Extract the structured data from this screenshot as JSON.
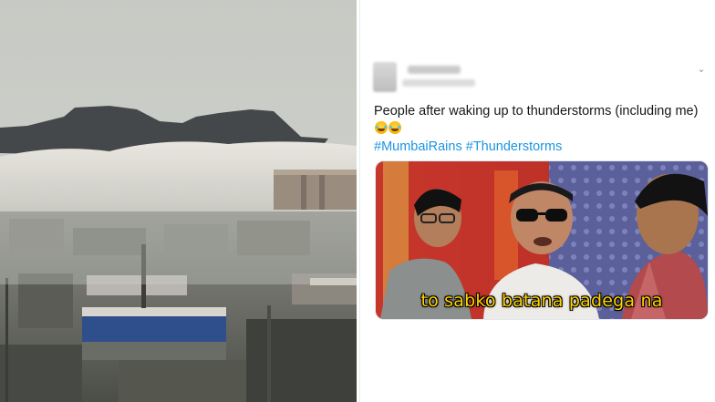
{
  "tweet": {
    "text": "People after waking up to thunderstorms (including me)",
    "hashtags": [
      "#MumbaiRains",
      "#Thunderstorms"
    ],
    "media_caption": "to sabko batana padega na"
  },
  "colors": {
    "hashtag": "#1b95e0",
    "caption": "#ffd400",
    "text": "#14171a"
  },
  "icons": {
    "menu": "chevron-down-icon",
    "emoji": "tears-of-joy-emoji"
  }
}
